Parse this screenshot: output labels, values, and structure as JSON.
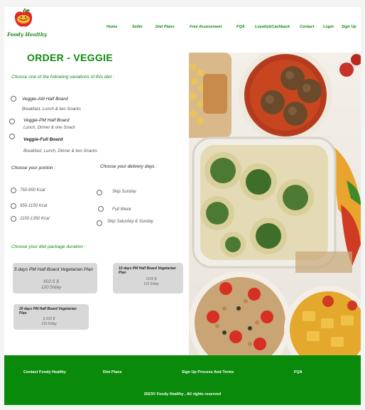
{
  "brand": {
    "name": "Foody Healthy"
  },
  "nav": [
    {
      "label": "Home"
    },
    {
      "label": "Seller"
    },
    {
      "label": "Diet Plans"
    },
    {
      "label": "Free Assessment"
    },
    {
      "label": "FQA"
    },
    {
      "label": "Loyalty&Cashback"
    },
    {
      "label": "Contact"
    },
    {
      "label": "Login"
    },
    {
      "label": "Sign Up"
    }
  ],
  "page": {
    "title": "ORDER - VEGGIE",
    "variation_prompt": "Choose one of the following variations of this diet :",
    "variations": [
      {
        "title": "Veggie-AM Half Board",
        "subtitle": "Breakfast, Lunch & two Snacks"
      },
      {
        "title": "Veggie-PM Half Board",
        "subtitle": "Lunch, Dinner & one Snack"
      },
      {
        "title": "Veggie-Full Board",
        "subtitle": "Breakfast, Lunch, Dinner & two Snacks"
      }
    ],
    "portion_label": "Choose your portion :",
    "portions": [
      {
        "label": "750-950 Kcal"
      },
      {
        "label": "950-1150 Kcal"
      },
      {
        "label": "1150-1350 Kcal"
      }
    ],
    "delivery_label": "Choose your delivery days :",
    "delivery_days": [
      {
        "label": "Skip Sunday"
      },
      {
        "label": "Full Week"
      },
      {
        "label": "Skip Saturday & Sunday"
      }
    ],
    "duration_label": "Choose your diet package duration :",
    "packages": [
      {
        "name": "5 days PM Half Board Vegetarian Plan",
        "price": "602.5 $",
        "per_day": "120.5/day"
      },
      {
        "name": "10 days PM Half Board Vegetarian Plan",
        "price": "1155 $",
        "per_day": "115.5/day"
      },
      {
        "name": "20 days PM Half Board Vegetarian Plan",
        "price": "2,210 $",
        "per_day": "110.5/day"
      }
    ]
  },
  "footer": {
    "links": [
      {
        "label": "Contact Foody Healthy"
      },
      {
        "label": "Diet Plans"
      },
      {
        "label": "Sign Up Process And Terms"
      },
      {
        "label": "FQA"
      }
    ],
    "copyright": "2023© Foody Healthy , All rights reserved"
  },
  "colors": {
    "brand_green": "#0f8a0f",
    "footer_green": "#0a8a0a",
    "card_gray": "#d8d8d8"
  }
}
